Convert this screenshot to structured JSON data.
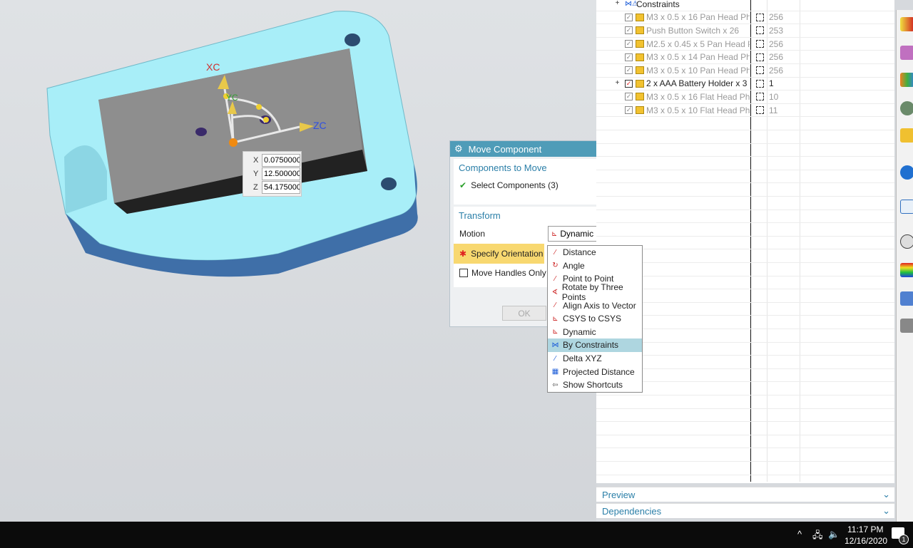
{
  "viewport": {
    "axis_labels": {
      "xc": "XC",
      "yc": "YC",
      "zc": "ZC"
    },
    "coord_input": {
      "x_label": "X",
      "x_value": "0.0750000",
      "y_label": "Y",
      "y_value": "12.500000",
      "z_label": "Z",
      "z_value": "54.175000"
    }
  },
  "dialog": {
    "title": "Move Component",
    "reset_icon": "refresh-icon",
    "close_icon": "close-icon",
    "components_group": {
      "title": "Components to Move",
      "select_label": "Select Components (3)"
    },
    "transform_group": {
      "title": "Transform",
      "motion_label": "Motion",
      "motion_value": "Dynamic",
      "specify_orientation": "Specify Orientation",
      "move_handles_only": "Move Handles Only",
      "move_handles_checked": false
    },
    "ok_label": "OK"
  },
  "dropdown": {
    "options": [
      "Distance",
      "Angle",
      "Point to Point",
      "Rotate by Three Points",
      "Align Axis to Vector",
      "CSYS to CSYS",
      "Dynamic",
      "By Constraints",
      "Delta XYZ",
      "Projected Distance",
      "Show Shortcuts"
    ],
    "highlighted": "By Constraints"
  },
  "tree": {
    "rows": [
      {
        "name": "Constraints",
        "count": ""
      },
      {
        "name": "M3 x 0.5 x 16 Pan Head Phi...",
        "count": "256"
      },
      {
        "name": "Push Button Switch x 26",
        "count": "253"
      },
      {
        "name": "M2.5 x 0.45 x 5 Pan Head P...",
        "count": "256"
      },
      {
        "name": "M3 x 0.5 x 14 Pan Head Phi...",
        "count": "256"
      },
      {
        "name": "M3 x 0.5 x 10 Pan Head Phi...",
        "count": "256"
      },
      {
        "name": "2 x AAA Battery Holder x 3",
        "count": "1"
      },
      {
        "name": "M3 x 0.5 x 16 Flat Head Phil...",
        "count": "10"
      },
      {
        "name": "M3 x 0.5 x 10 Flat Head Phil...",
        "count": "11"
      }
    ],
    "preview": "Preview",
    "dependencies": "Dependencies"
  },
  "taskbar": {
    "time": "11:17 PM",
    "date": "12/16/2020",
    "notifications": "1"
  },
  "colors": {
    "accent": "#4f9cb8",
    "plate": "#a8eef8",
    "highlight": "#aed6e0",
    "required": "#f8d870"
  }
}
